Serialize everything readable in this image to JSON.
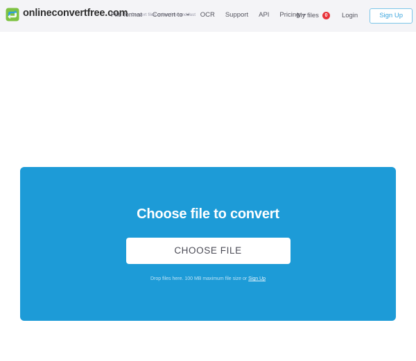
{
  "header": {
    "logo": {
      "icon": "convert-arrows-icon",
      "title": "onlineconvertfree.com",
      "tagline": "Convert files online free and fast"
    },
    "nav": [
      {
        "label": "File format",
        "has_caret": false
      },
      {
        "label": "Convert to",
        "has_caret": true
      },
      {
        "label": "OCR",
        "has_caret": false
      },
      {
        "label": "Support",
        "has_caret": false
      },
      {
        "label": "API",
        "has_caret": false
      },
      {
        "label": "Pricing",
        "has_caret": true
      }
    ],
    "my_files": {
      "label": "My files",
      "count": "0"
    },
    "login_label": "Login",
    "signup_label": "Sign Up"
  },
  "main": {
    "upload": {
      "title": "Choose file to convert",
      "button_label": "CHOOSE FILE",
      "hint_prefix": "Drop files here. 100 MB maximum file size or ",
      "hint_link": "Sign Up"
    }
  },
  "colors": {
    "accent_blue": "#1d9bd7",
    "badge_red": "#e8333a",
    "header_bg": "#f4f4f7",
    "nav_text": "#55555f"
  }
}
